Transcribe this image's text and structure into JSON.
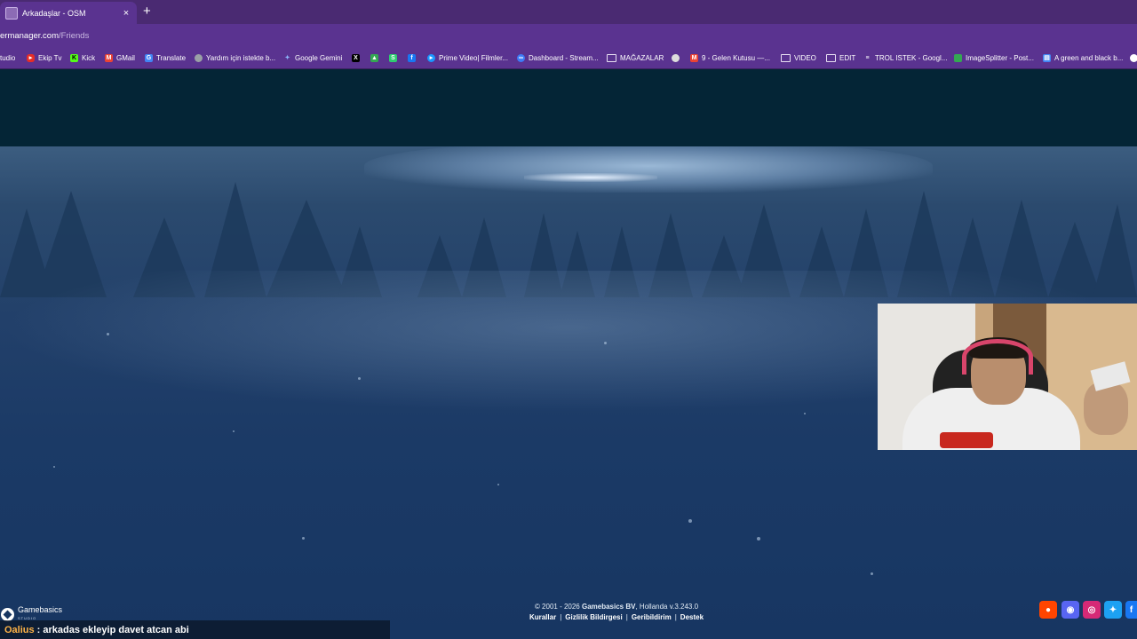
{
  "tab": {
    "title": "Arkadaşlar - OSM",
    "close": "×",
    "new_tab": "+"
  },
  "address": {
    "host": "ermanager.com",
    "path": "/Friends"
  },
  "bookmarks": [
    {
      "label": "tudio",
      "color": "transparent",
      "icon": ""
    },
    {
      "label": "Ekip Tv",
      "color": "#e52d27",
      "icon": "play-icon"
    },
    {
      "label": "Kick",
      "color": "#53fc18",
      "icon": "kick-icon"
    },
    {
      "label": "GMail",
      "color": "#ea4335",
      "icon": "gmail-icon"
    },
    {
      "label": "Translate",
      "color": "#4285f4",
      "icon": "translate-icon"
    },
    {
      "label": "Yardım için istekte b...",
      "color": "#9aa0a6",
      "icon": "globe-icon"
    },
    {
      "label": "Google Gemini",
      "color": "#8ab4f8",
      "icon": "gemini-icon"
    },
    {
      "label": "",
      "color": "#000000",
      "icon": "x-icon"
    },
    {
      "label": "",
      "color": "#34a853",
      "icon": "drive-icon"
    },
    {
      "label": "",
      "color": "#2ecc71",
      "icon": "green-app-icon"
    },
    {
      "label": "",
      "color": "#1877f2",
      "icon": "facebook-icon"
    },
    {
      "label": "Prime Video| Filmler...",
      "color": "#1a98ff",
      "icon": "prime-icon"
    },
    {
      "label": "Dashboard - Stream...",
      "color": "#3d7bf7",
      "icon": "dashboard-icon"
    },
    {
      "label": "MAĞAZALAR",
      "color": "transparent",
      "icon": "folder-icon"
    },
    {
      "label": "",
      "color": "#dddddd",
      "icon": "ball-icon"
    },
    {
      "label": "9 - Gelen Kutusu —...",
      "color": "#ea4335",
      "icon": "gmail-icon"
    },
    {
      "label": "VIDEO",
      "color": "transparent",
      "icon": "folder-icon"
    },
    {
      "label": "EDIT",
      "color": "transparent",
      "icon": "folder-icon"
    },
    {
      "label": "TROL ISTEK - Googl...",
      "color": "#4285f4",
      "icon": "list-icon"
    },
    {
      "label": "ImageSplitter - Post...",
      "color": "#34a853",
      "icon": "splitter-icon"
    },
    {
      "label": "A green and black b...",
      "color": "#4285f4",
      "icon": "doc-icon"
    }
  ],
  "footer": {
    "copy_prefix": "© 2001 - 2026 ",
    "copy_brand": "Gamebasics BV",
    "copy_suffix": ", Hollanda v.3.243.0",
    "links": [
      "Kurallar",
      "Gizlilik Bildirgesi",
      "Geribildirim",
      "Destek"
    ]
  },
  "logo": {
    "name": "Gamebasics",
    "sub": "STUDIO"
  },
  "chat": {
    "user": "Oalius",
    "message": ": arkadas ekleyip davet atcan abi"
  },
  "social": [
    {
      "name": "reddit-icon",
      "color": "#ff4500",
      "glyph": "●"
    },
    {
      "name": "discord-icon",
      "color": "#5865f2",
      "glyph": "◉"
    },
    {
      "name": "instagram-icon",
      "color": "#d62976",
      "glyph": "◎"
    },
    {
      "name": "twitter-icon",
      "color": "#1da1f2",
      "glyph": "✦"
    },
    {
      "name": "facebook-icon",
      "color": "#1877f2",
      "glyph": "f"
    }
  ]
}
